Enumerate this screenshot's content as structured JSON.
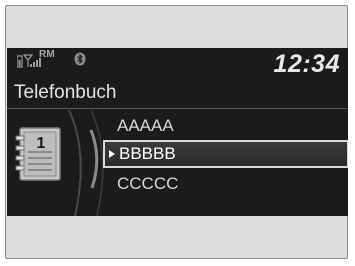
{
  "status": {
    "carrier_badge": "RM",
    "time": "12:34"
  },
  "screen_title": "Telefonbuch",
  "phonebook_icon_number": "1",
  "contacts": [
    {
      "name": "AAAAA"
    },
    {
      "name": "BBBBB",
      "selected": true
    },
    {
      "name": "CCCCC"
    }
  ],
  "icons": {
    "battery": "battery-icon",
    "signal": "signal-strength-icon",
    "bluetooth": "bluetooth-icon",
    "phonebook": "phonebook-icon"
  },
  "colors": {
    "screen_bg": "#1b1b1b",
    "text": "#e2e2e2",
    "selection_border": "#d9d9d9"
  }
}
